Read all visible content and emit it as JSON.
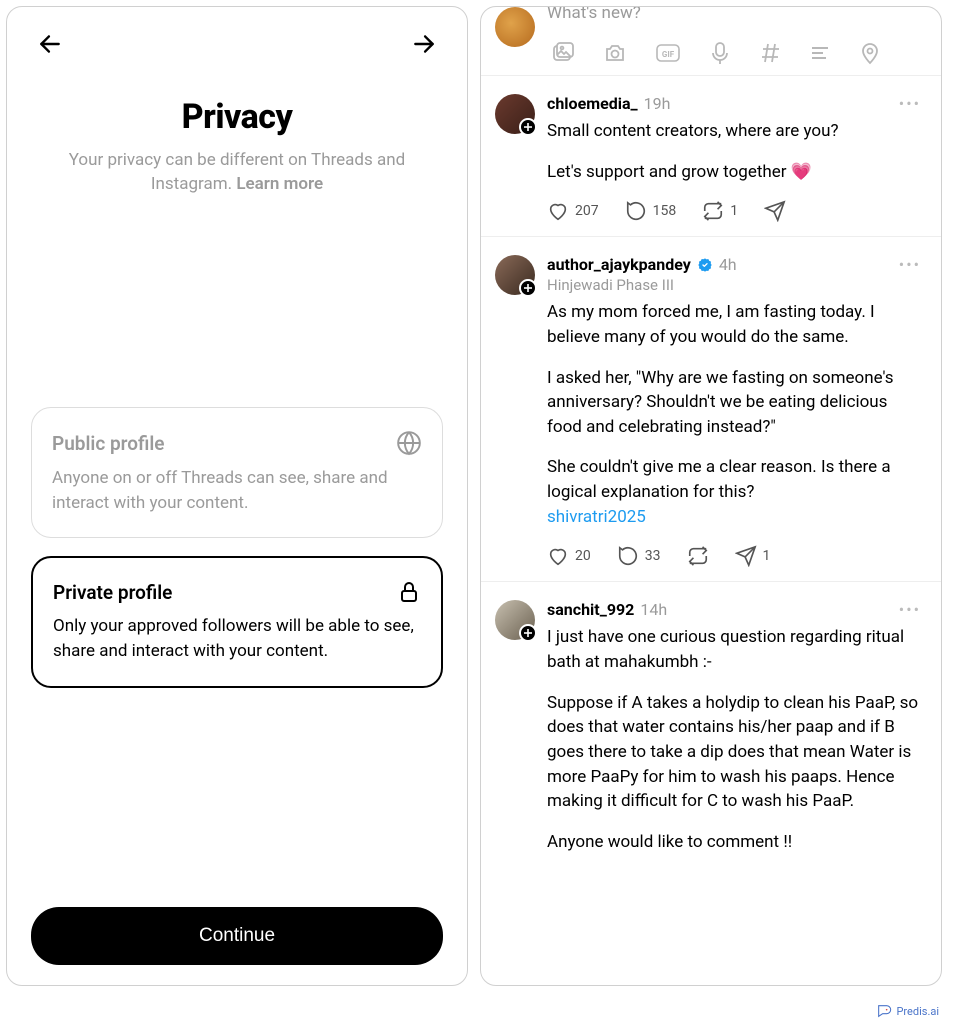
{
  "left": {
    "title": "Privacy",
    "subtitle_pre": "Your privacy can be different on Threads and Instagram. ",
    "subtitle_link": "Learn more",
    "options": [
      {
        "title": "Public profile",
        "desc": "Anyone on or off Threads can see, share and interact with your content.",
        "selected": false
      },
      {
        "title": "Private profile",
        "desc": "Only your approved followers will be able to see, share and interact with your content.",
        "selected": true
      }
    ],
    "continue": "Continue"
  },
  "right": {
    "composer": {
      "placeholder": "What's new?"
    },
    "posts": [
      {
        "username": "chloemedia_",
        "time": "19h",
        "paragraphs": [
          "Small content creators, where are you?",
          "Let's support and grow together 💗"
        ],
        "likes": "207",
        "comments": "158",
        "reposts": "1",
        "shares": ""
      },
      {
        "username": "author_ajaykpandey",
        "verified": true,
        "time": "4h",
        "location": "Hinjewadi Phase III",
        "paragraphs": [
          "As my mom forced me, I am fasting today. I believe many of you would do the same.",
          "I asked her, \"Why are we fasting on someone's anniversary? Shouldn't we be eating delicious food and celebrating instead?\"",
          "She couldn't give me a clear reason. Is there a logical explanation for this?"
        ],
        "hashtag": "shivratri2025",
        "likes": "20",
        "comments": "33",
        "reposts": "",
        "shares": "1"
      },
      {
        "username": "sanchit_992",
        "time": "14h",
        "paragraphs": [
          "I just have one curious question regarding ritual bath  at mahakumbh :-",
          "Suppose if A takes a holydip to clean his PaaP, so does that water contains his/her paap and if B goes there to take a dip does that mean Water is more PaaPy for him to wash his paaps. Hence making it difficult for C to wash his PaaP.",
          "Anyone would like to comment !!"
        ]
      }
    ]
  },
  "watermark": "Predis.ai"
}
